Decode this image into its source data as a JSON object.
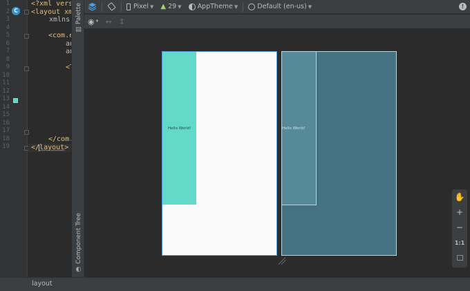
{
  "editor": {
    "line_numbers": [
      "1",
      "2",
      "3",
      "4",
      "5",
      "6",
      "7",
      "8",
      "9",
      "10",
      "11",
      "12",
      "13",
      "14",
      "15",
      "16",
      "17",
      "18",
      "19"
    ],
    "lines": {
      "l1": "<?xml vers",
      "l2": "<layout xm",
      "l3": "xmlns:",
      "l4": "<com.e",
      "l5": "an",
      "l6": "an",
      "l9": "<T",
      "l18": "</com.",
      "l19_open": "</",
      "l19_tag": "layout",
      "l19_close": ">"
    },
    "gutter_badge": "C"
  },
  "palette_strip": {
    "palette_label": "Palette",
    "component_tree_label": "Component Tree"
  },
  "toolbar": {
    "device_label": "Pixel",
    "api_level": "29",
    "theme_label": "AppTheme",
    "locale_label": "Default (en-us)"
  },
  "canvas": {
    "design_text": "Hello World!",
    "blueprint_text": "Hello World!",
    "design_accent_color": "#63dac9",
    "blueprint_color": "#447283"
  },
  "zoom": {
    "zoom_in": "+",
    "zoom_out": "−",
    "actual_size": "1:1"
  },
  "status": {
    "label": "layout"
  }
}
